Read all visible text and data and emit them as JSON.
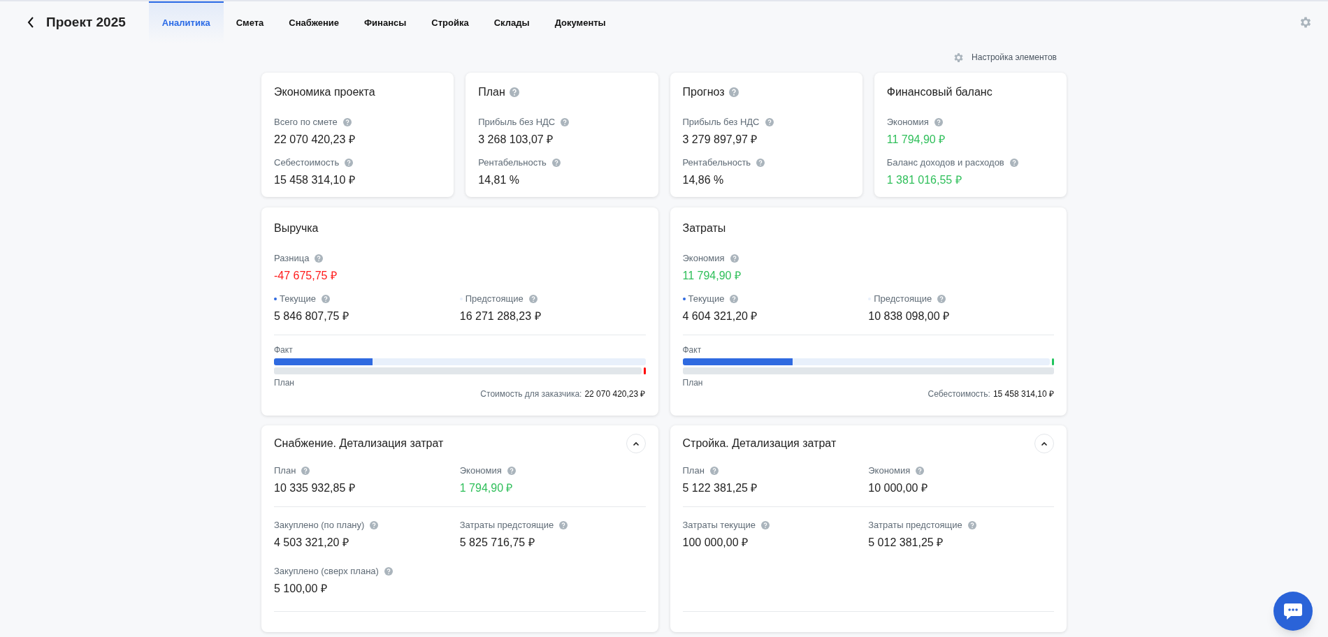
{
  "header": {
    "title": "Проект 2025",
    "tabs": [
      {
        "label": "Аналитика",
        "selected": true
      },
      {
        "label": "Смета",
        "selected": false
      },
      {
        "label": "Снабжение",
        "selected": false
      },
      {
        "label": "Финансы",
        "selected": false
      },
      {
        "label": "Стройка",
        "selected": false
      },
      {
        "label": "Склады",
        "selected": false
      },
      {
        "label": "Документы",
        "selected": false
      }
    ]
  },
  "settings_link": "Настройка элементов",
  "summary_cards": [
    {
      "title": "Экономика проекта",
      "help": false,
      "metrics": [
        {
          "label": "Всего по смете",
          "value": "22 070 420,23 ₽",
          "color": "#222222"
        },
        {
          "label": "Себестоимость",
          "value": "15 458 314,10 ₽",
          "color": "#222222"
        }
      ]
    },
    {
      "title": "План",
      "help": true,
      "metrics": [
        {
          "label": "Прибыль без НДС",
          "value": "3 268 103,07 ₽",
          "color": "#222222"
        },
        {
          "label": "Рентабельность",
          "value": "14,81 %",
          "color": "#222222"
        }
      ]
    },
    {
      "title": "Прогноз",
      "help": true,
      "metrics": [
        {
          "label": "Прибыль без НДС",
          "value": "3 279 897,97 ₽",
          "color": "#222222"
        },
        {
          "label": "Рентабельность",
          "value": "14,86 %",
          "color": "#222222"
        }
      ]
    },
    {
      "title": "Финансовый баланс",
      "help": false,
      "metrics": [
        {
          "label": "Экономия",
          "value": "11 794,90 ₽",
          "color": "#2fbf5a"
        },
        {
          "label": "Баланс доходов и расходов",
          "value": "1 381 016,55 ₽",
          "color": "#2fbf5a"
        }
      ]
    }
  ],
  "progress_cards": [
    {
      "title": "Выручка",
      "difference": {
        "label": "Разница",
        "value": "-47 675,75 ₽",
        "color": "#ff1a1a"
      },
      "split": [
        {
          "label": "Текущие",
          "value": "5 846 807,75 ₽",
          "color": "#2f6ae0"
        },
        {
          "label": "Предстоящие",
          "value": "16 271 288,23 ₽",
          "color": "#e8f0fb"
        }
      ],
      "fact_bar": {
        "label": "Факт",
        "level": 0.265
      },
      "plan_bar": {
        "label": "План",
        "end_mark": {
          "color": "#ff0000"
        }
      },
      "total_label": "Стоимость для заказчика:",
      "total_value": "22 070 420,23 ₽"
    },
    {
      "title": "Затраты",
      "difference": {
        "label": "Экономия",
        "value": "11 794,90 ₽",
        "color": "#2fbf5a"
      },
      "split": [
        {
          "label": "Текущие",
          "value": "4 604 321,20 ₽",
          "color": "#2f6ae0"
        },
        {
          "label": "Предстоящие",
          "value": "10 838 098,00 ₽",
          "color": "#e8f0fb"
        }
      ],
      "fact_bar": {
        "label": "Факт",
        "level": 0.3,
        "end_mark": {
          "color": "#22c55e"
        }
      },
      "plan_bar": {
        "label": "План"
      },
      "total_label": "Себестоимость:",
      "total_value": "15 458 314,10 ₽"
    }
  ],
  "detail_cards": [
    {
      "title": "Снабжение. Детализация затрат",
      "expanded": true,
      "sections": [
        [
          {
            "label": "План",
            "value": "10 335 932,85 ₽",
            "color": "#222222"
          },
          {
            "label": "Экономия",
            "value": "1 794,90 ₽",
            "color": "#2fbf5a"
          }
        ],
        [
          {
            "label": "Закуплено (по плану)",
            "value": "4 503 321,20 ₽",
            "color": "#222222"
          },
          {
            "label": "Затраты предстоящие",
            "value": "5 825 716,75 ₽",
            "color": "#222222"
          },
          {
            "label": "Закуплено (сверх плана)",
            "value": "5 100,00 ₽",
            "color": "#222222"
          }
        ]
      ]
    },
    {
      "title": "Стройка. Детализация затрат",
      "expanded": true,
      "sections": [
        [
          {
            "label": "План",
            "value": "5 122 381,25 ₽",
            "color": "#222222"
          },
          {
            "label": "Экономия",
            "value": "10 000,00 ₽",
            "color": "#222222"
          }
        ],
        [
          {
            "label": "Затраты текущие",
            "value": "100 000,00 ₽",
            "color": "#222222"
          },
          {
            "label": "Затраты предстоящие",
            "value": "5 012 381,25 ₽",
            "color": "#222222"
          }
        ]
      ]
    }
  ]
}
